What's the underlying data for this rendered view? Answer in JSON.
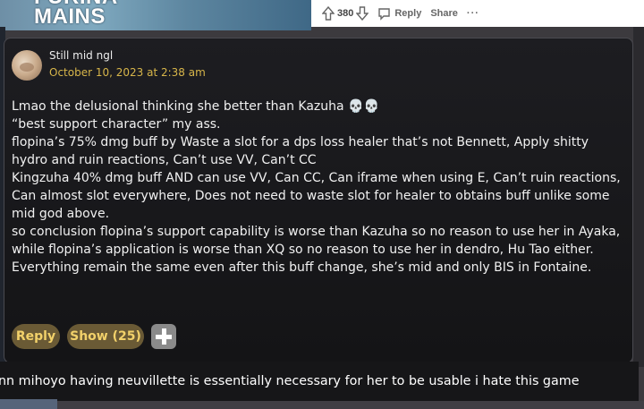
{
  "banner": {
    "title_lines": [
      "FURINA",
      "MAINS"
    ]
  },
  "vote_bar": {
    "upvote_icon": "arrow-up-icon",
    "score": "380",
    "downvote_icon": "arrow-down-icon",
    "reply_icon": "speech-bubble-icon",
    "reply_label": "Reply",
    "share_label": "Share",
    "more_label": "···"
  },
  "comment": {
    "username": "Still mid ngl",
    "date": "October 10, 2023 at 2:38 am",
    "avatar_icon": "user-avatar",
    "body_lines": [
      "Lmao the delusional thinking she better than Kazuha 💀💀",
      "“best support character” my ass.",
      "flopina’s 75% dmg buff by Waste a slot for a dps loss healer that’s not Bennett, Apply shitty hydro and ruin reactions, Can’t use VV, Can’t CC",
      "Kingzuha 40% dmg buff AND can use VV, Can CC, Can iframe when using E, Can’t ruin reactions, Can almost slot everywhere, Does not need to waste slot for healer to obtains buff unlike some mid god above.",
      "so conclusion flopina’s support capability is worse than Kazuha so no reason to use her in Ayaka, while flopina’s application is worse than XQ so no reason to use her in dendro, Hu Tao either.",
      "Everything remain the same even after this buff change, she’s mid and only BIS in Fontaine."
    ],
    "reply_button": "Reply",
    "show_button": "Show (25)",
    "plus_icon": "plus-icon"
  },
  "caption": {
    "text": "nn mihoyo having neuvillette is essentially necessary for her to be usable i hate this game"
  },
  "colors": {
    "card_bg": "#18181b",
    "accent_gold": "#d7b54a",
    "button_bg": "#6a5a35",
    "button_text": "#f2d16a"
  }
}
